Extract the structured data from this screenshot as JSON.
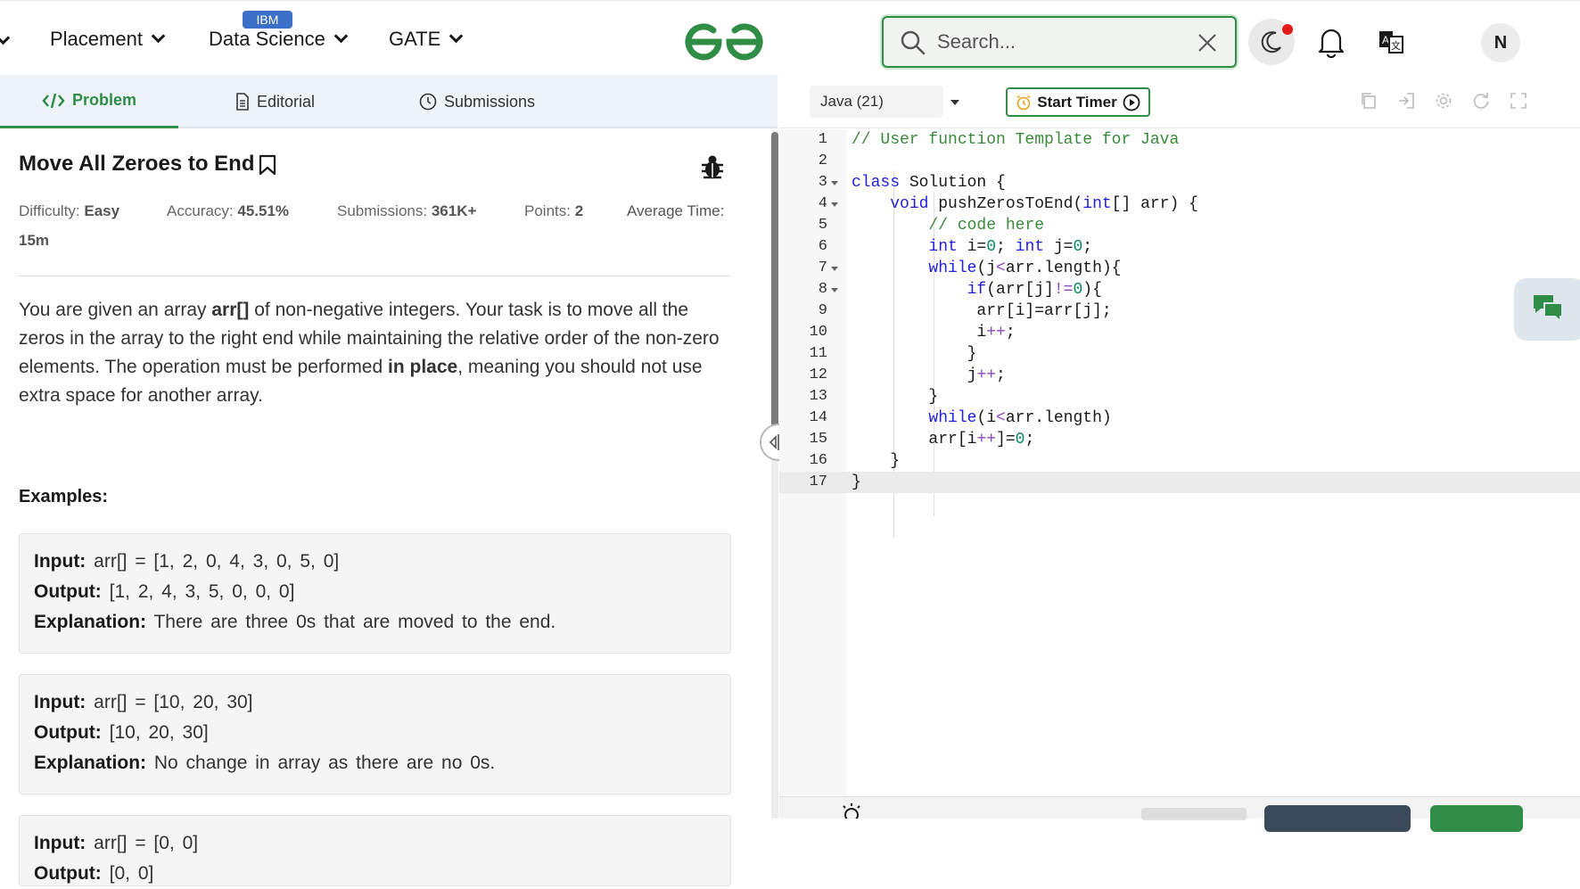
{
  "nav": {
    "items": [
      {
        "label": "Placement"
      },
      {
        "label": "Data Science",
        "badge": "IBM"
      },
      {
        "label": "GATE"
      }
    ],
    "search_placeholder": "Search...",
    "avatar_initial": "N",
    "brand_color": "#2f8d46",
    "icons": [
      "search-icon",
      "close-icon",
      "moon-icon",
      "bell-icon",
      "translate-icon"
    ]
  },
  "tabs": [
    {
      "label": "Problem",
      "icon": "code-icon",
      "active": true
    },
    {
      "label": "Editorial",
      "icon": "document-icon"
    },
    {
      "label": "Submissions",
      "icon": "clock-icon"
    }
  ],
  "problem": {
    "title": "Move All Zeroes to End",
    "difficulty_label": "Difficulty:",
    "difficulty": "Easy",
    "accuracy_label": "Accuracy:",
    "accuracy": "45.51%",
    "submissions_label": "Submissions:",
    "submissions": "361K+",
    "points_label": "Points:",
    "points": "2",
    "avg_time_label": "Average Time:",
    "avg_time": "15m",
    "desc_1": "You are given an array ",
    "desc_arr": "arr[]",
    "desc_2": " of non-negative integers. Your task is to move all the zeros in the array to the right end while maintaining the relative order of the non-zero elements. The operation must be performed ",
    "desc_inplace": "in place",
    "desc_3": ", meaning you should not use extra space for another array.",
    "examples_heading": "Examples:",
    "examples": [
      {
        "input": "arr[] = [1, 2, 0, 4, 3, 0, 5, 0]",
        "output": "[1, 2, 4, 3, 5, 0, 0, 0]",
        "explanation": "There are three 0s that are moved to the end."
      },
      {
        "input": "arr[] = [10, 20, 30]",
        "output": "[10, 20, 30]",
        "explanation": "No change in array as there are no 0s."
      },
      {
        "input": "arr[] = [0, 0]",
        "output": "[0, 0]"
      }
    ],
    "input_label": "Input:",
    "output_label": "Output:",
    "explanation_label": "Explanation:"
  },
  "editor": {
    "language": "Java (21)",
    "timer_label": "Start Timer",
    "lines": [
      "// User function Template for Java",
      "",
      "class Solution {",
      "    void pushZerosToEnd(int[] arr) {",
      "        // code here",
      "        int i=0; int j=0;",
      "        while(j<arr.length){",
      "            if(arr[j]!=0){",
      "             arr[i]=arr[j];",
      "             i++;",
      "            }",
      "            j++;",
      "        }",
      "        while(i<arr.length)",
      "        arr[i++]=0;",
      "    }",
      "}"
    ]
  }
}
